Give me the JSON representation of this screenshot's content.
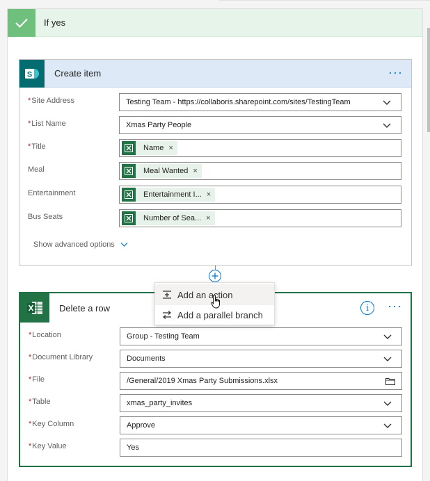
{
  "condition": {
    "label": "If yes",
    "accent": "#6fc07d"
  },
  "create_item": {
    "title": "Create item",
    "more_label": "···",
    "fields": [
      {
        "label": "Site Address",
        "required": true,
        "value": "Testing Team - https://collaboris.sharepoint.com/sites/TestingTeam",
        "control": "dropdown"
      },
      {
        "label": "List Name",
        "required": true,
        "value": "Xmas Party People",
        "control": "dropdown"
      },
      {
        "label": "Title",
        "required": true,
        "token": "Name",
        "control": "token"
      },
      {
        "label": "Meal",
        "required": false,
        "token": "Meal Wanted",
        "control": "token"
      },
      {
        "label": "Entertainment",
        "required": false,
        "token": "Entertainment I...",
        "control": "token"
      },
      {
        "label": "Bus Seats",
        "required": false,
        "token": "Number of Sea...",
        "control": "token"
      }
    ],
    "advanced_label": "Show advanced options",
    "brand_color": "#036c70"
  },
  "insert_menu": {
    "items": [
      {
        "label": "Add an action",
        "icon": "add-action-icon"
      },
      {
        "label": "Add a parallel branch",
        "icon": "parallel-branch-icon"
      }
    ]
  },
  "delete_row": {
    "title": "Delete a row",
    "info_label": "i",
    "more_label": "···",
    "brand_color": "#217346",
    "fields": [
      {
        "label": "Location",
        "required": true,
        "value": "Group - Testing Team",
        "control": "dropdown"
      },
      {
        "label": "Document Library",
        "required": true,
        "value": "Documents",
        "control": "dropdown"
      },
      {
        "label": "File",
        "required": true,
        "value": "/General/2019 Xmas Party Submissions.xlsx",
        "control": "file"
      },
      {
        "label": "Table",
        "required": true,
        "value": "xmas_party_invites",
        "control": "dropdown"
      },
      {
        "label": "Key Column",
        "required": true,
        "value": "Approve",
        "control": "dropdown"
      },
      {
        "label": "Key Value",
        "required": true,
        "value": "Yes",
        "control": "text"
      }
    ]
  },
  "token_x": "×",
  "required_mark": "*"
}
